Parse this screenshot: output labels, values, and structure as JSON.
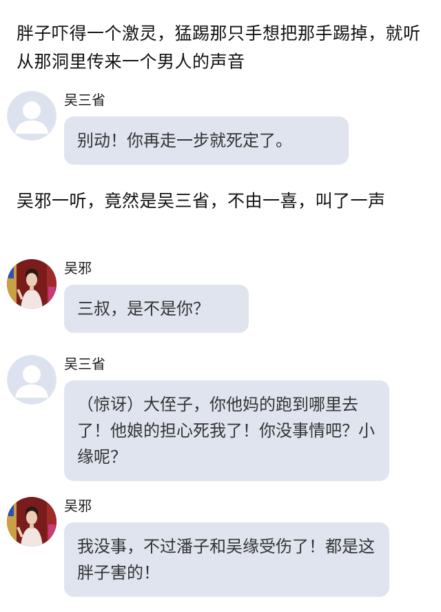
{
  "narration_1": "胖子吓得一个激灵，猛踢那只手想把那手踢掉，就听从那洞里传来一个男人的声音",
  "narration_2": "吴邪一听，竟然是吴三省，不由一喜，叫了一声",
  "messages": [
    {
      "sender": "吴三省",
      "avatar": "default-user-avatar",
      "text": "别动！你再走一步就死定了。"
    },
    {
      "sender": "吴邪",
      "avatar": "character-photo-avatar",
      "text": "三叔，是不是你？"
    },
    {
      "sender": "吴三省",
      "avatar": "default-user-avatar",
      "text": "（惊讶）大侄子，你他妈的跑到哪里去了！他娘的担心死我了！你没事情吧？小缘呢？"
    },
    {
      "sender": "吴邪",
      "avatar": "character-photo-avatar",
      "text": "我没事，不过潘子和吴缘受伤了！都是这胖子害的！"
    }
  ],
  "colors": {
    "bubble_bg": "#dfe4ee",
    "bubble_text": "#333333",
    "narration_text": "#111111",
    "default_avatar_bg": "#dde3ee",
    "default_avatar_fg": "#ffffff"
  }
}
